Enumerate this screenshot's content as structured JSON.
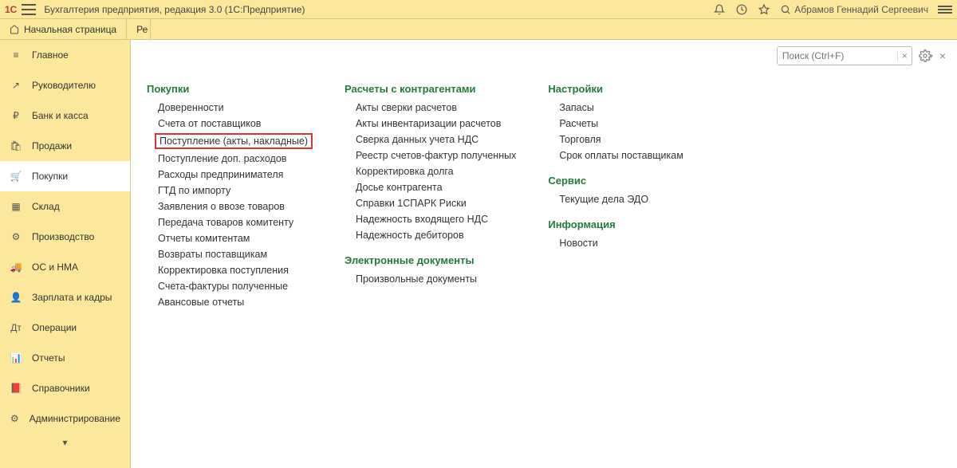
{
  "topbar": {
    "logo": "1С",
    "title": "Бухгалтерия предприятия, редакция 3.0   (1С:Предприятие)",
    "user": "Абрамов Геннадий Сергеевич"
  },
  "tabs": {
    "home": "Начальная страница",
    "cut": "Ре"
  },
  "sidebar": {
    "items": [
      {
        "label": "Главное",
        "icon": "≡"
      },
      {
        "label": "Руководителю",
        "icon": "↗"
      },
      {
        "label": "Банк и касса",
        "icon": "₽"
      },
      {
        "label": "Продажи",
        "icon": "🛍"
      },
      {
        "label": "Покупки",
        "icon": "🛒"
      },
      {
        "label": "Склад",
        "icon": "▦"
      },
      {
        "label": "Производство",
        "icon": "⚙"
      },
      {
        "label": "ОС и НМА",
        "icon": "🚚"
      },
      {
        "label": "Зарплата и кадры",
        "icon": "👤"
      },
      {
        "label": "Операции",
        "icon": "Дт"
      },
      {
        "label": "Отчеты",
        "icon": "📊"
      },
      {
        "label": "Справочники",
        "icon": "📕"
      },
      {
        "label": "Администрирование",
        "icon": "⚙"
      }
    ]
  },
  "search": {
    "placeholder": "Поиск (Ctrl+F)",
    "clear": "×"
  },
  "sections": {
    "col1": {
      "h1": "Покупки",
      "links": [
        "Доверенности",
        "Счета от поставщиков",
        "Поступление (акты, накладные)",
        "Поступление доп. расходов",
        "Расходы предпринимателя",
        "ГТД по импорту",
        "Заявления о ввозе товаров",
        "Передача товаров комитенту",
        "Отчеты комитентам",
        "Возвраты поставщикам",
        "Корректировка поступления",
        "Счета-фактуры полученные",
        "Авансовые отчеты"
      ]
    },
    "col2": {
      "h1": "Расчеты с контрагентами",
      "links1": [
        "Акты сверки расчетов",
        "Акты инвентаризации расчетов",
        "Сверка данных учета НДС",
        "Реестр счетов-фактур полученных",
        "Корректировка долга",
        "Досье контрагента",
        "Справки 1СПАРК Риски",
        "Надежность входящего НДС",
        "Надежность дебиторов"
      ],
      "h2": "Электронные документы",
      "links2": [
        "Произвольные документы"
      ]
    },
    "col3": {
      "h1": "Настройки",
      "links1": [
        "Запасы",
        "Расчеты",
        "Торговля",
        "Срок оплаты поставщикам"
      ],
      "h2": "Сервис",
      "links2": [
        "Текущие дела ЭДО"
      ],
      "h3": "Информация",
      "links3": [
        "Новости"
      ]
    }
  }
}
